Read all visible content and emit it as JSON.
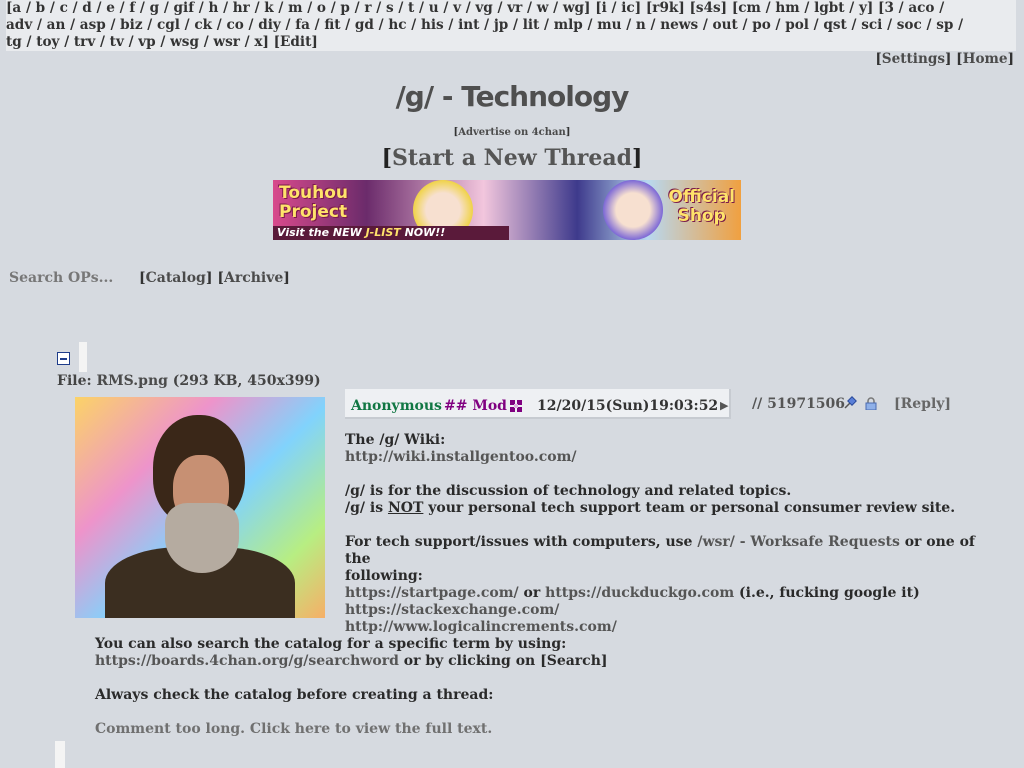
{
  "nav": {
    "line1": "[a / b / c / d / e / f / g / gif / h / hr / k / m / o / p / r / s / t / u / v / vg / vr / w / wg] [i / ic] [r9k] [s4s] [cm / hm / lgbt / y] [3 / aco /",
    "line2": "adv / an / asp / biz / cgl / ck / co / diy / fa / fit / gd / hc / his / int / jp / lit / mlp / mu / n / news / out / po / pol / qst / sci / soc / sp /",
    "line3": "tg / toy / trv / tv / vp / wsg / wsr / x] [Edit]"
  },
  "top_right": {
    "settings": "Settings",
    "home": "Home"
  },
  "board_title": "/g/ - Technology",
  "advertise": "Advertise on 4chan",
  "start_thread": "Start a New Thread",
  "banner": {
    "line1a": "Touhou",
    "line1b": "Project",
    "line2a": "Official",
    "line2b": "Shop",
    "strip_a": "Visit the NEW ",
    "strip_b": "J-LIST",
    "strip_c": " NOW!!"
  },
  "search_placeholder": "Search OPs...",
  "catalog_label": "Catalog",
  "archive_label": "Archive",
  "post": {
    "file_label": "File: ",
    "file_name": "RMS.png",
    "file_meta": " (293 KB, 450x399)",
    "name": "Anonymous",
    "capcode": "## Mod",
    "date": "12/20/15(Sun)19:03:52",
    "menu_arrow": "▶",
    "post_no": "// 51971506",
    "reply": "[Reply]",
    "wiki_heading": "The /g/ Wiki:",
    "wiki_url": "http://wiki.installgentoo.com/",
    "desc1": "/g/ is for the discussion of technology and related topics.",
    "desc2_a": "/g/ is ",
    "desc2_not": "NOT",
    "desc2_b": " your personal tech support team or personal consumer review site.",
    "support_a": "For tech support/issues with computers, use ",
    "support_link": "/wsr/ - Worksafe Requests",
    "support_b": " or one of the",
    "support_c": "following:",
    "startpage": "https://startpage.com/",
    "or": " or ",
    "ddg": "https://duckduckgo.com",
    "google_note": " (i.e., fucking google it)",
    "stackexchange": "https://stackexchange.com/",
    "logical": "http://www.logicalincrements.com/",
    "catalog_search_a": "You can also search the catalog for a specific term by using:",
    "catalog_search_url": "https://boards.4chan.org/g/searchword",
    "catalog_search_b": " or by clicking on [Search]",
    "always_check": "Always check the catalog before creating a thread:",
    "too_long": "Comment too long. Click here to view the full text."
  },
  "colors": {
    "background": "#d6dae0",
    "name": "#117743",
    "capcode": "#800080"
  }
}
